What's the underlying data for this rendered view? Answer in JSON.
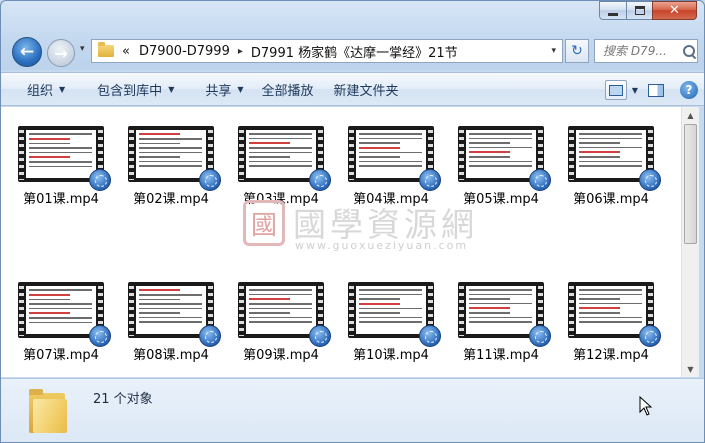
{
  "window": {
    "caption": {
      "minimize": "minimize",
      "maximize": "maximize",
      "close": "✕"
    }
  },
  "nav": {
    "history_glyph": "▾",
    "address": {
      "overflow": "«",
      "crumbs": [
        "D7900-D7999",
        "D7991 杨家鹤《达摩一掌经》21节"
      ],
      "separator": "▸",
      "dropdown": "▾"
    },
    "refresh_glyph": "↻",
    "search_placeholder": "搜索 D79..."
  },
  "toolbar": {
    "organize": "组织",
    "include_in_library": "包含到库中",
    "share": "共享",
    "play_all": "全部播放",
    "new_folder": "新建文件夹",
    "help": "?"
  },
  "files": [
    "第01课.mp4",
    "第02课.mp4",
    "第03课.mp4",
    "第04课.mp4",
    "第05课.mp4",
    "第06课.mp4",
    "第07课.mp4",
    "第08课.mp4",
    "第09课.mp4",
    "第10课.mp4",
    "第11课.mp4",
    "第12课.mp4"
  ],
  "watermark": {
    "seal": "國",
    "title": "國學資源網",
    "url": "www.guoxueziyuan.com"
  },
  "status": {
    "object_count": "21 个对象"
  },
  "icons": [
    "back-arrow-icon",
    "forward-arrow-icon",
    "folder-icon",
    "refresh-icon",
    "search-icon",
    "view-icon",
    "preview-pane-icon",
    "help-icon",
    "video-file-icon",
    "cursor-icon"
  ]
}
